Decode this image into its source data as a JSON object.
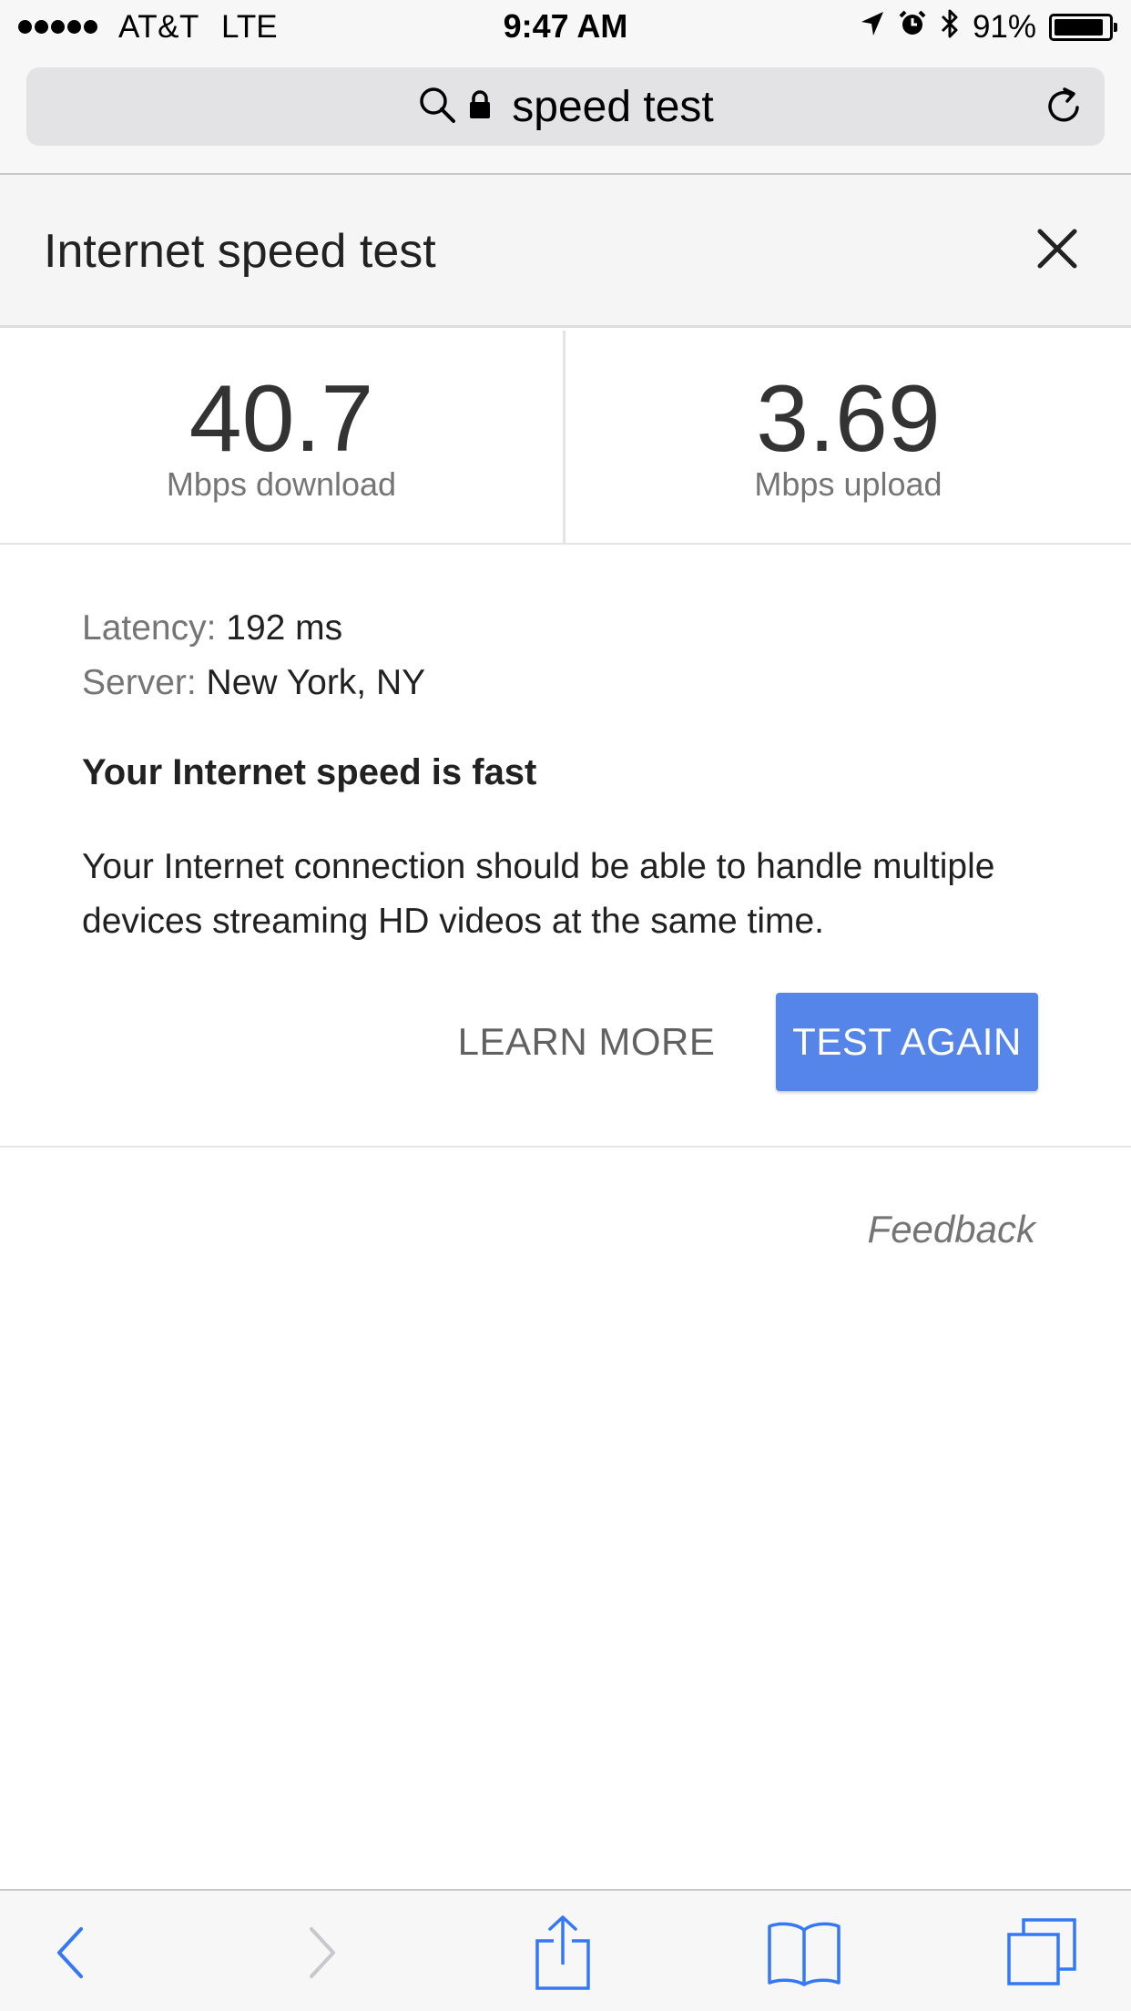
{
  "status_bar": {
    "carrier": "AT&T",
    "network": "LTE",
    "time": "9:47 AM",
    "battery_percent": "91%",
    "battery_level": 0.91,
    "icons": [
      "location-arrow-icon",
      "alarm-icon",
      "bluetooth-icon",
      "battery-icon"
    ]
  },
  "address_bar": {
    "query": "speed test",
    "icons": [
      "search-icon",
      "lock-icon",
      "reload-icon"
    ]
  },
  "card": {
    "title": "Internet speed test",
    "close_icon": "close-icon"
  },
  "results": {
    "download_value": "40.7",
    "download_label": "Mbps download",
    "upload_value": "3.69",
    "upload_label": "Mbps upload"
  },
  "details": {
    "latency_key": "Latency:",
    "latency_value": "192 ms",
    "server_key": "Server:",
    "server_value": "New York, NY"
  },
  "verdict": "Your Internet speed is fast",
  "description": "Your Internet connection should be able to handle multiple devices streaming HD videos at the same time.",
  "actions": {
    "learn_more": "LEARN MORE",
    "test_again": "TEST AGAIN"
  },
  "feedback": "Feedback",
  "toolbar": {
    "items": [
      "back-icon",
      "forward-icon",
      "share-icon",
      "bookmarks-icon",
      "tabs-icon"
    ]
  },
  "colors": {
    "accent": "#5585e8",
    "toolbar_blue": "#3478f6",
    "toolbar_disabled": "#c7c7cc",
    "muted_text": "#757575"
  }
}
